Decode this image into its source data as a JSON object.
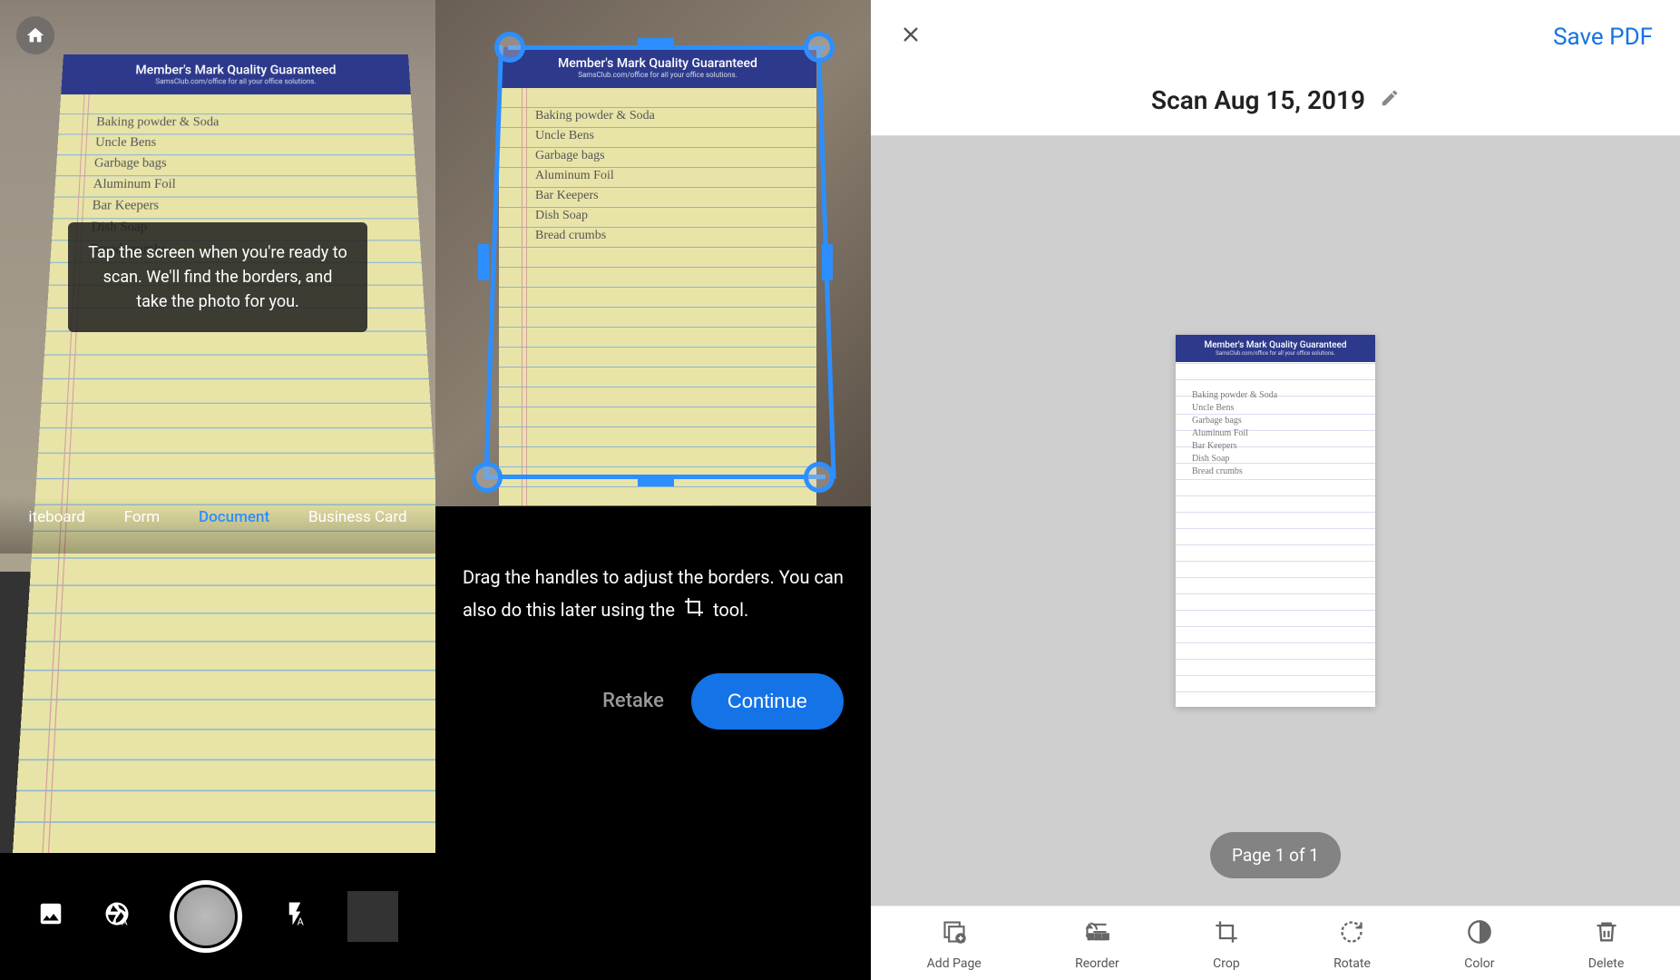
{
  "notepad": {
    "brand_title": "Member's Mark Quality Guaranteed",
    "brand_subtitle": "SamsClub.com/office for all your office solutions.",
    "list_items": [
      "Baking powder & Soda",
      "Uncle Bens",
      "Garbage bags",
      "Aluminum Foil",
      "Bar Keepers",
      "Dish Soap",
      "Bread crumbs"
    ]
  },
  "panel1": {
    "tooltip": "Tap the screen when you're ready to scan. We'll find the borders, and take the photo for you.",
    "scan_types": {
      "whiteboard": "iteboard",
      "form": "Form",
      "document": "Document",
      "business_card": "Business Card"
    }
  },
  "panel2": {
    "instructions_a": "Drag the handles to adjust the borders. You can also do this later using the",
    "instructions_b": "tool.",
    "retake": "Retake",
    "continue": "Continue"
  },
  "panel3": {
    "save_pdf": "Save PDF",
    "scan_title": "Scan Aug 15, 2019",
    "page_badge": "Page 1 of 1",
    "toolbar": {
      "add_page": "Add Page",
      "reorder": "Reorder",
      "crop": "Crop",
      "rotate": "Rotate",
      "color": "Color",
      "delete": "Delete"
    }
  }
}
